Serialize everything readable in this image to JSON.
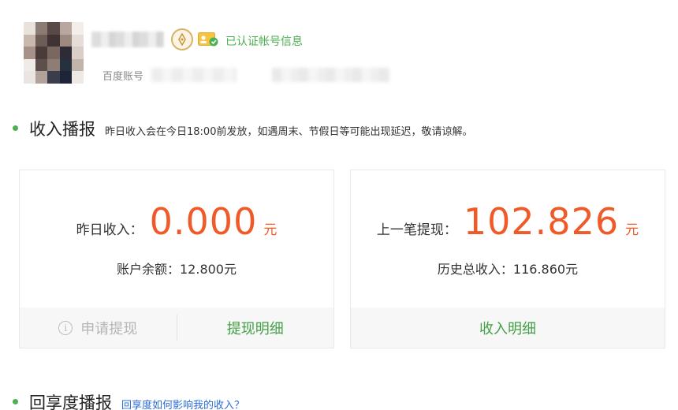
{
  "header": {
    "verified_text": "已认证帐号信息",
    "account_label": "百度账号",
    "icons": [
      "avatar-blurred",
      "pen-badge-icon",
      "verified-card-icon"
    ]
  },
  "income_section": {
    "title": "收入播报",
    "note": "昨日收入会在今日18:00前发放，如遇周末、节假日等可能出现延迟，敬请谅解。"
  },
  "left_card": {
    "label": "昨日收入：",
    "value": "0.000",
    "unit": "元",
    "sub": "账户余额：12.800元",
    "apply_label": "申请提现",
    "detail_label": "提现明细"
  },
  "right_card": {
    "label": "上一笔提现：",
    "value": "102.826",
    "unit": "元",
    "sub": "历史总收入：116.860元",
    "detail_label": "收入明细"
  },
  "share_section": {
    "title": "回享度播报",
    "link": "回享度如何影响我的收入？"
  },
  "colors": {
    "accent_green": "#4caf50",
    "value_orange": "#f05a28",
    "link_blue": "#2b6cd9"
  }
}
